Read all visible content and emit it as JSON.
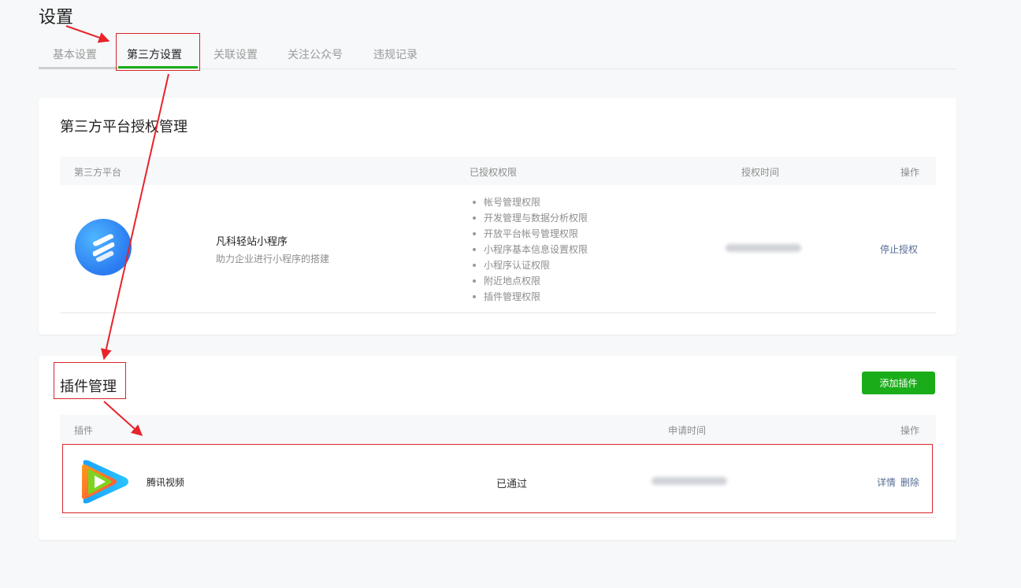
{
  "page": {
    "title": "设置"
  },
  "tabs": [
    {
      "label": "基本设置",
      "active": false
    },
    {
      "label": "第三方设置",
      "active": true
    },
    {
      "label": "关联设置",
      "active": false
    },
    {
      "label": "关注公众号",
      "active": false
    },
    {
      "label": "违规记录",
      "active": false
    }
  ],
  "thirdparty": {
    "title": "第三方平台授权管理",
    "columns": {
      "platform": "第三方平台",
      "permissions": "已授权权限",
      "auth_time": "授权时间",
      "action": "操作"
    },
    "rows": [
      {
        "icon": "app-logo-icon",
        "name": "凡科轻站小程序",
        "desc": "助力企业进行小程序的搭建",
        "permissions": [
          "帐号管理权限",
          "开发管理与数据分析权限",
          "开放平台帐号管理权限",
          "小程序基本信息设置权限",
          "小程序认证权限",
          "附近地点权限",
          "插件管理权限"
        ],
        "auth_time": "",
        "action": "停止授权"
      }
    ]
  },
  "plugins": {
    "title": "插件管理",
    "add_label": "添加插件",
    "columns": {
      "plugin": "插件",
      "apply_time": "申请时间",
      "action": "操作"
    },
    "rows": [
      {
        "icon": "tencent-video-icon",
        "name": "腾讯视频",
        "status": "已通过",
        "apply_time": "",
        "detail": "详情",
        "delete": "删除"
      }
    ]
  },
  "colors": {
    "accent": "#1aad19",
    "link": "#576b95",
    "annotation": "#d7262b"
  }
}
